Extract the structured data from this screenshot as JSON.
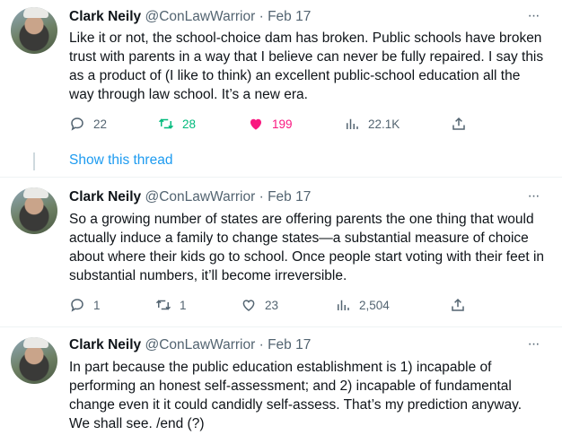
{
  "tweets": [
    {
      "name": "Clark Neily",
      "handle": "@ConLawWarrior",
      "sep": "·",
      "date": "Feb 17",
      "text": "Like it or not, the school-choice dam has broken. Public schools have broken trust with parents in a way that I believe can never be fully repaired. I say this as a product of (I like to think) an excellent public-school education all the way through law school. It’s a new era.",
      "replies": "22",
      "retweets": "28",
      "likes": "199",
      "views": "22.1K"
    },
    {
      "name": "Clark Neily",
      "handle": "@ConLawWarrior",
      "sep": "·",
      "date": "Feb 17",
      "text": "So a growing number of states are offering parents the one thing that would actually induce a family to change states—a substantial measure of choice about where their kids go to school. Once people start voting with their feet in substantial numbers, it’ll become irreversible.",
      "replies": "1",
      "retweets": "1",
      "likes": "23",
      "views": "2,504"
    },
    {
      "name": "Clark Neily",
      "handle": "@ConLawWarrior",
      "sep": "·",
      "date": "Feb 17",
      "text": "In part because the public education establishment is 1) incapable of performing an honest self-assessment; and 2) incapable of fundamental change even it it could candidly self-assess. That’s my prediction anyway. We shall see. /end (?)"
    }
  ],
  "show_thread": "Show this thread",
  "more_glyph": "···",
  "colors": {
    "retweet_green": "#00ba7c",
    "like_pink": "#f91880",
    "link_blue": "#1d9bf0",
    "muted": "#536471"
  },
  "icons": [
    "reply-icon",
    "retweet-icon",
    "like-icon",
    "views-icon",
    "share-icon",
    "more-icon"
  ]
}
